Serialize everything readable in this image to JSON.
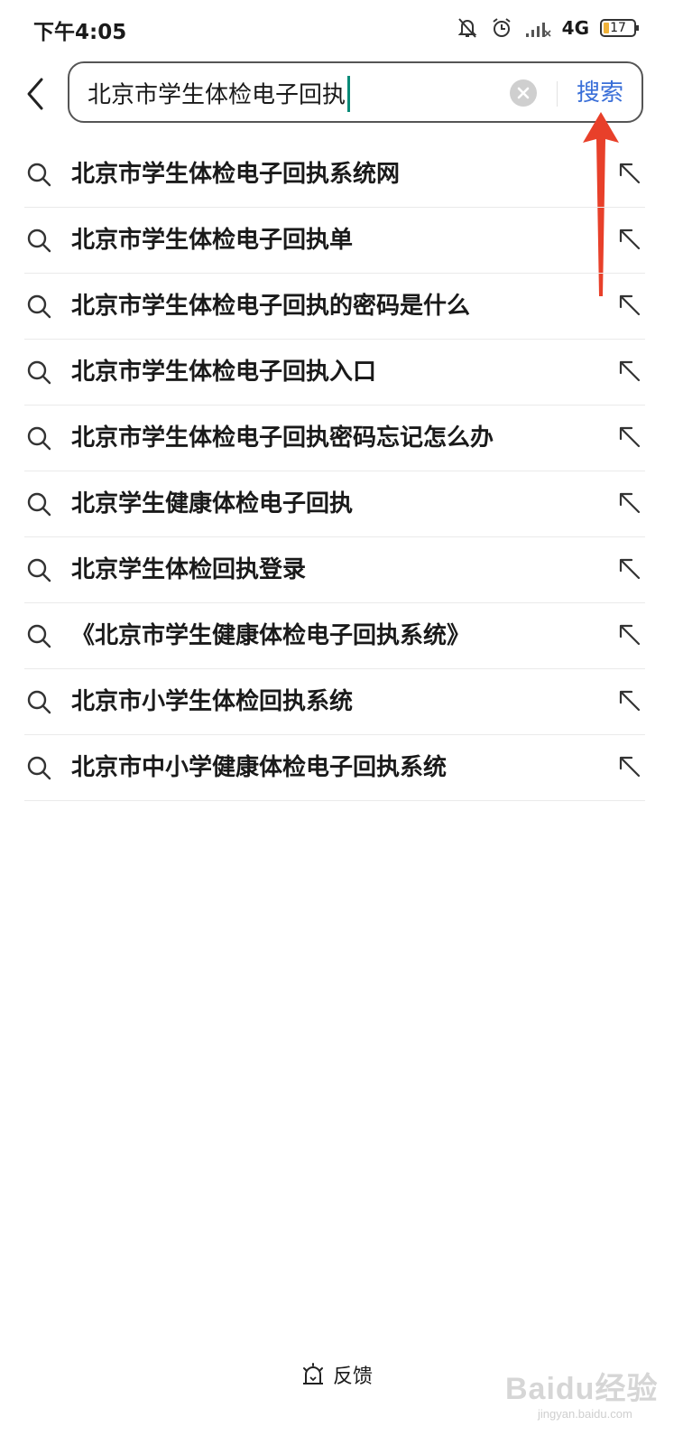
{
  "status_bar": {
    "time": "下午4:05",
    "network": "4G",
    "battery": "17",
    "icons": [
      "mute-bell-icon",
      "alarm-clock-icon",
      "signal-icon",
      "battery-icon"
    ]
  },
  "search": {
    "query": "北京市学生体检电子回执",
    "button_label": "搜索",
    "accent_color": "#3a6fd8"
  },
  "suggestions": [
    "北京市学生体检电子回执系统网",
    "北京市学生体检电子回执单",
    "北京市学生体检电子回执的密码是什么",
    "北京市学生体检电子回执入口",
    "北京市学生体检电子回执密码忘记怎么办",
    "北京学生健康体检电子回执",
    "北京学生体检回执登录",
    "《北京市学生健康体检电子回执系统》",
    "北京市小学生体检回执系统",
    "北京市中小学健康体检电子回执系统"
  ],
  "feedback": {
    "label": "反馈"
  },
  "watermark": {
    "text": "Baidu经验",
    "sub": "jingyan.baidu.com"
  }
}
